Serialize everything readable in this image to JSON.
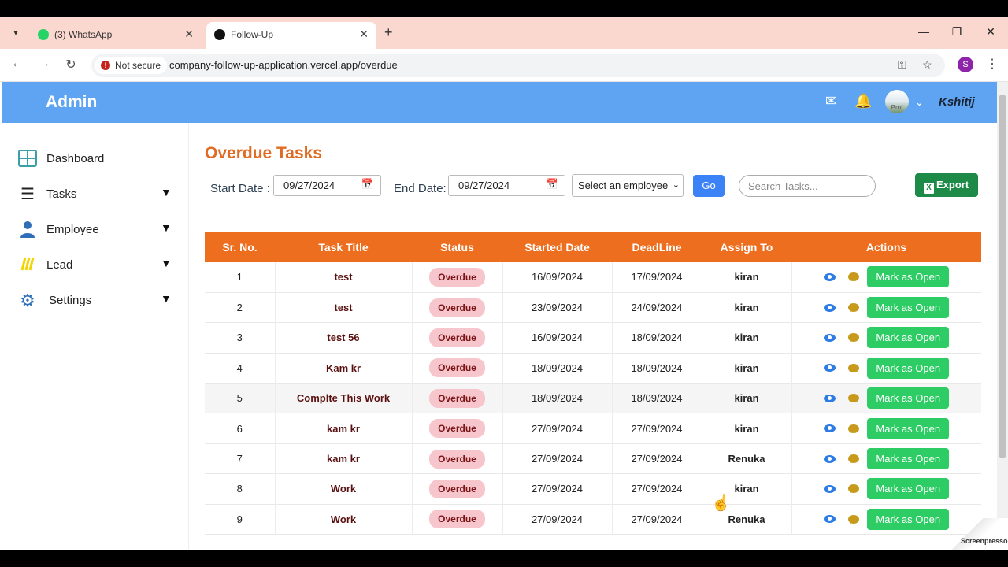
{
  "browser": {
    "tabs": [
      {
        "title": "(3) WhatsApp",
        "close": "✕"
      },
      {
        "title": "Follow-Up",
        "close": "✕"
      }
    ],
    "new_tab": "+",
    "security_label": "Not secure",
    "url": "company-follow-up-application.vercel.app/overdue",
    "profile_initial": "S"
  },
  "header": {
    "brand": "Admin",
    "avatar_alt": "Prof",
    "username": "Kshitij"
  },
  "sidebar": {
    "items": [
      {
        "label": "Dashboard",
        "icon": "dashboard-icon",
        "expandable": false
      },
      {
        "label": "Tasks",
        "icon": "tasks-icon",
        "expandable": true
      },
      {
        "label": "Employee",
        "icon": "employee-icon",
        "expandable": true
      },
      {
        "label": "Lead",
        "icon": "lead-icon",
        "expandable": true
      },
      {
        "label": "Settings",
        "icon": "gear-icon",
        "expandable": true
      }
    ]
  },
  "main": {
    "title": "Overdue Tasks",
    "filters": {
      "start_label": "Start Date :",
      "start_value": "09/27/2024",
      "end_label": "End Date:",
      "end_value": "09/27/2024",
      "employee_select": "Select an employee",
      "go_label": "Go",
      "search_placeholder": "Search Tasks...",
      "export_label": "Export"
    },
    "table": {
      "columns": [
        "Sr. No.",
        "Task Title",
        "Status",
        "Started Date",
        "DeadLine",
        "Assign To",
        "Actions"
      ],
      "action_label": "Mark as Open",
      "rows": [
        {
          "sr": "1",
          "title": "test",
          "status": "Overdue",
          "started": "16/09/2024",
          "deadline": "17/09/2024",
          "assignee": "kiran"
        },
        {
          "sr": "2",
          "title": "test",
          "status": "Overdue",
          "started": "23/09/2024",
          "deadline": "24/09/2024",
          "assignee": "kiran"
        },
        {
          "sr": "3",
          "title": "test 56",
          "status": "Overdue",
          "started": "16/09/2024",
          "deadline": "18/09/2024",
          "assignee": "kiran"
        },
        {
          "sr": "4",
          "title": "Kam kr",
          "status": "Overdue",
          "started": "18/09/2024",
          "deadline": "18/09/2024",
          "assignee": "kiran"
        },
        {
          "sr": "5",
          "title": "Complte This Work",
          "status": "Overdue",
          "started": "18/09/2024",
          "deadline": "18/09/2024",
          "assignee": "kiran"
        },
        {
          "sr": "6",
          "title": "kam kr",
          "status": "Overdue",
          "started": "27/09/2024",
          "deadline": "27/09/2024",
          "assignee": "kiran"
        },
        {
          "sr": "7",
          "title": "kam kr",
          "status": "Overdue",
          "started": "27/09/2024",
          "deadline": "27/09/2024",
          "assignee": "Renuka"
        },
        {
          "sr": "8",
          "title": "Work",
          "status": "Overdue",
          "started": "27/09/2024",
          "deadline": "27/09/2024",
          "assignee": "kiran"
        },
        {
          "sr": "9",
          "title": "Work",
          "status": "Overdue",
          "started": "27/09/2024",
          "deadline": "27/09/2024",
          "assignee": "Renuka"
        }
      ]
    }
  },
  "watermark": "Screenpresso"
}
